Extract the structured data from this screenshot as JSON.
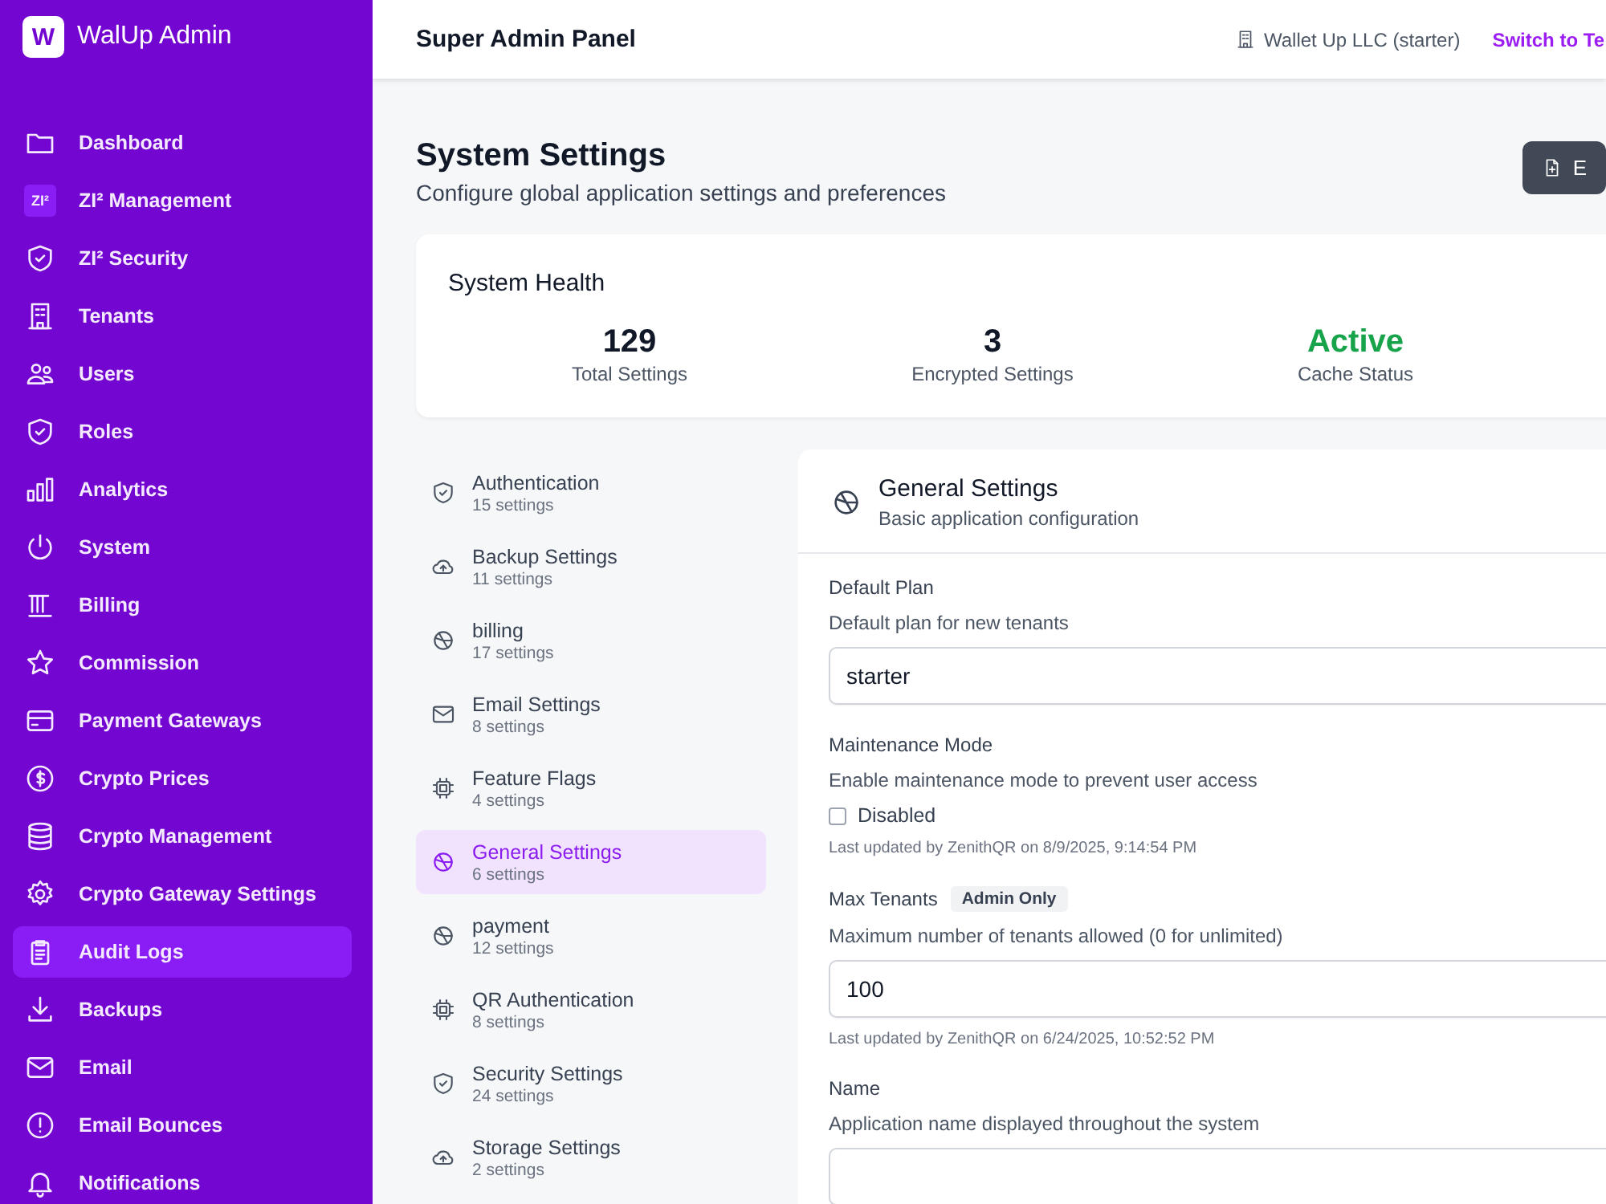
{
  "sidebar": {
    "logo": "W",
    "title": "WalUp Admin",
    "items": [
      {
        "label": "Dashboard",
        "selected": false
      },
      {
        "badge": "ZI²",
        "label": "ZI² Management",
        "selected": false
      },
      {
        "label": "ZI² Security",
        "selected": false
      },
      {
        "label": "Tenants",
        "selected": false
      },
      {
        "label": "Users",
        "selected": false
      },
      {
        "label": "Roles",
        "selected": false
      },
      {
        "label": "Analytics",
        "selected": false
      },
      {
        "label": "System",
        "selected": false
      },
      {
        "label": "Billing",
        "selected": false
      },
      {
        "label": "Commission",
        "selected": false
      },
      {
        "label": "Payment Gateways",
        "selected": false
      },
      {
        "label": "Crypto Prices",
        "selected": false
      },
      {
        "label": "Crypto Management",
        "selected": false
      },
      {
        "label": "Crypto Gateway Settings",
        "selected": false
      },
      {
        "label": "Audit Logs",
        "selected": true
      },
      {
        "label": "Backups",
        "selected": false
      },
      {
        "label": "Email",
        "selected": false
      },
      {
        "label": "Email Bounces",
        "selected": false
      },
      {
        "label": "Notifications",
        "selected": false
      }
    ]
  },
  "header": {
    "title": "Super Admin Panel",
    "tenant": "Wallet Up LLC (starter)",
    "switch_link": "Switch to Te"
  },
  "page": {
    "title": "System Settings",
    "subtitle": "Configure global application settings and preferences",
    "action_button": "E"
  },
  "health": {
    "title": "System Health",
    "stats": [
      {
        "kind": "number",
        "value": "129",
        "label": "Total Settings"
      },
      {
        "kind": "number",
        "value": "3",
        "label": "Encrypted Settings"
      },
      {
        "kind": "status",
        "value": "Active",
        "label": "Cache Status"
      }
    ]
  },
  "categories": [
    {
      "name": "Authentication",
      "count": "15 settings",
      "selected": false
    },
    {
      "name": "Backup Settings",
      "count": "11 settings",
      "selected": false
    },
    {
      "name": "billing",
      "count": "17 settings",
      "selected": false
    },
    {
      "name": "Email Settings",
      "count": "8 settings",
      "selected": false
    },
    {
      "name": "Feature Flags",
      "count": "4 settings",
      "selected": false
    },
    {
      "name": "General Settings",
      "count": "6 settings",
      "selected": true
    },
    {
      "name": "payment",
      "count": "12 settings",
      "selected": false
    },
    {
      "name": "QR Authentication",
      "count": "8 settings",
      "selected": false
    },
    {
      "name": "Security Settings",
      "count": "24 settings",
      "selected": false
    },
    {
      "name": "Storage Settings",
      "count": "2 settings",
      "selected": false
    }
  ],
  "settings_panel": {
    "title": "General Settings",
    "subtitle": "Basic application configuration",
    "fields": [
      {
        "kind": "text",
        "label": "Default Plan",
        "description": "Default plan for new tenants",
        "value": "starter"
      },
      {
        "kind": "checkbox",
        "label": "Maintenance Mode",
        "description": "Enable maintenance mode to prevent user access",
        "checked": false,
        "option": "Disabled",
        "updated": "Last updated by ZenithQR on 8/9/2025, 9:14:54 PM"
      },
      {
        "kind": "text",
        "label": "Max Tenants",
        "badge": "Admin Only",
        "description": "Maximum number of tenants allowed (0 for unlimited)",
        "value": "100",
        "updated": "Last updated by ZenithQR on 6/24/2025, 10:52:52 PM"
      },
      {
        "kind": "text",
        "label": "Name",
        "description": "Application name displayed throughout the system"
      }
    ]
  }
}
